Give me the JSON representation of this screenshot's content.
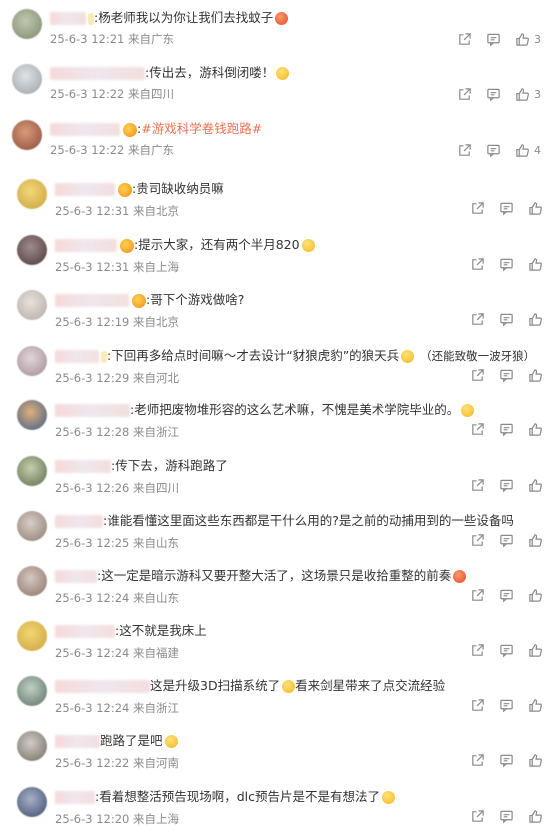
{
  "comments": [
    {
      "text": ":杨老师我以为你让我们去找蚊子",
      "date": "25-6-3 12:21",
      "location": "来自广东",
      "likes": "3",
      "badge": "fan-badge",
      "emoji": "angry-emoji"
    },
    {
      "text": ":传出去，游科倒闭喽！",
      "date": "25-6-3 12:22",
      "location": "来自四川",
      "likes": "3",
      "badge": "",
      "emoji": "laugh-emoji"
    },
    {
      "text_prefix": ":",
      "topic": "#游戏科学卷钱跑路#",
      "date": "25-6-3 12:22",
      "location": "来自广东",
      "likes": "4",
      "badge": "crown-badge",
      "emoji": ""
    },
    {
      "text": ":贵司缺收纳员嘛",
      "date": "25-6-3 12:31",
      "location": "来自北京",
      "likes": "",
      "badge": "crown-badge",
      "emoji": ""
    },
    {
      "text": ":提示大家，还有两个半月820",
      "date": "25-6-3 12:31",
      "location": "来自上海",
      "likes": "",
      "badge": "crown-badge",
      "emoji": "scream-emoji"
    },
    {
      "text": ":哥下个游戏做啥?",
      "date": "25-6-3 12:19",
      "location": "来自北京",
      "likes": "",
      "badge": "crown-badge",
      "emoji": ""
    },
    {
      "text": ":下回再多给点时间嘛～才去设计“豺狼虎豹”的狼天兵",
      "text2": "（还能致敬一波牙狼）",
      "date": "25-6-3 12:29",
      "location": "来自河北",
      "likes": "",
      "badge": "fan-badge",
      "emoji": "cry-emoji"
    },
    {
      "text": ":老师把废物堆形容的这么艺术嘛，不愧是美术学院毕业的。",
      "date": "25-6-3 12:28",
      "location": "来自浙江",
      "likes": "",
      "badge": "",
      "emoji": "sweat-emoji"
    },
    {
      "text": ":传下去，游科跑路了",
      "date": "25-6-3 12:26",
      "location": "来自四川",
      "likes": "",
      "badge": "",
      "emoji": ""
    },
    {
      "text": ":谁能看懂这里面这些东西都是干什么用的?是之前的动捕用到的一些设备吗",
      "date": "25-6-3 12:25",
      "location": "来自山东",
      "likes": "",
      "badge": "",
      "emoji": ""
    },
    {
      "text": ":这一定是暗示游科又要开整大活了，这场景只是收拾重整的前奏",
      "date": "25-6-3 12:24",
      "location": "来自山东",
      "likes": "",
      "badge": "",
      "emoji": "love-emoji"
    },
    {
      "text": ":这不就是我床上",
      "date": "25-6-3 12:24",
      "location": "来自福建",
      "likes": "",
      "badge": "",
      "emoji": ""
    },
    {
      "text": "这是升级3D扫描系统了",
      "text2": "看来剑星带来了点交流经验",
      "date": "25-6-3 12:24",
      "location": "来自浙江",
      "likes": "",
      "badge": "",
      "emoji": "think-emoji"
    },
    {
      "text": "跑路了是吧",
      "date": "25-6-3 12:22",
      "location": "来自河南",
      "likes": "",
      "badge": "",
      "emoji": "wow-emoji"
    },
    {
      "text": ":看着想整活预告现场啊，dlc预告片是不是有想法了",
      "date": "25-6-3 12:20",
      "location": "来自上海",
      "likes": "",
      "badge": "",
      "emoji": "wow-emoji"
    }
  ],
  "colors": {
    "topic": "#eb7350",
    "meta": "#8a8a8a",
    "text": "#333333"
  },
  "icons": [
    "share-icon",
    "comment-icon",
    "like-icon"
  ]
}
